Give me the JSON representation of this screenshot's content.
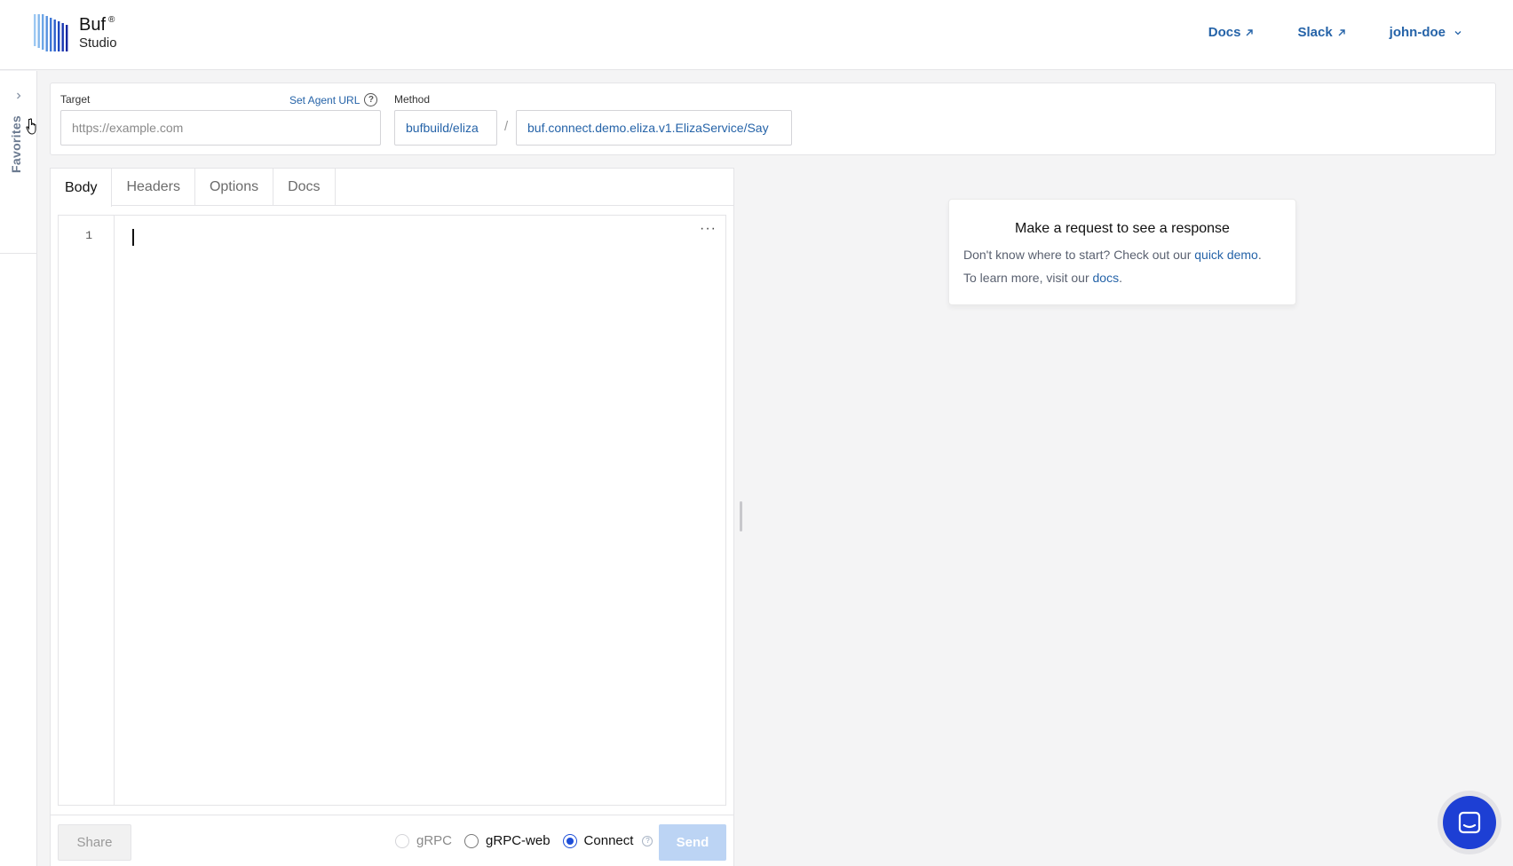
{
  "brand": {
    "name": "Buf",
    "registered": "®",
    "product": "Studio"
  },
  "nav": {
    "docs": "Docs",
    "slack": "Slack",
    "user": "john-doe"
  },
  "sidebar": {
    "favorites": "Favorites"
  },
  "request": {
    "target_label": "Target",
    "agent_link": "Set Agent URL",
    "help_glyph": "?",
    "target_placeholder": "https://example.com",
    "method_label": "Method",
    "module": "bufbuild/eliza",
    "separator": "/",
    "method": "buf.connect.demo.eliza.v1.ElizaService/Say"
  },
  "tabs": [
    {
      "label": "Body"
    },
    {
      "label": "Headers"
    },
    {
      "label": "Options"
    },
    {
      "label": "Docs"
    }
  ],
  "editor": {
    "line_number": "1",
    "more": "···"
  },
  "footer": {
    "share": "Share",
    "protocols": [
      {
        "label": "gRPC",
        "state": "disabled"
      },
      {
        "label": "gRPC-web",
        "state": "unchecked"
      },
      {
        "label": "Connect",
        "state": "checked"
      }
    ],
    "send": "Send"
  },
  "response": {
    "title": "Make a request to see a response",
    "line1_prefix": "Don't know where to start? Check out our ",
    "line1_link": "quick demo",
    "line1_suffix": ".",
    "line2_prefix": "To learn more, visit our ",
    "line2_link": "docs",
    "line2_suffix": "."
  },
  "colors": {
    "accent": "#2563a8",
    "primary": "#1d4ed8",
    "send_disabled": "#bcd4f4",
    "chat": "#1d3fd4"
  },
  "icons": {
    "logo": "buf-logo-icon",
    "external": "external-link-icon",
    "chevron_down": "chevron-down-icon",
    "chevron_right": "chevron-right-icon",
    "help": "help-icon",
    "chat": "chat-icon",
    "cursor": "cursor-icon"
  }
}
